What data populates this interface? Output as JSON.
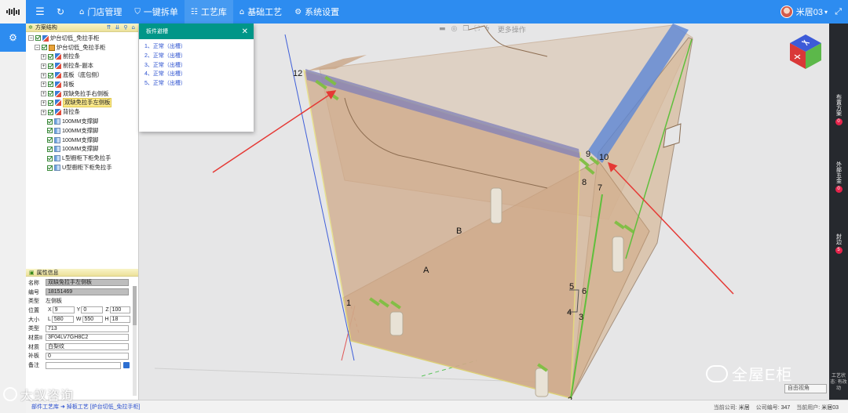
{
  "app": {
    "nav": [
      {
        "icon": "⌂",
        "label": "门店管理"
      },
      {
        "icon": "⛉",
        "label": "一键拆单"
      },
      {
        "icon": "☷",
        "label": "工艺库",
        "active": true
      },
      {
        "icon": "⌂",
        "label": "基础工艺"
      },
      {
        "icon": "⚙",
        "label": "系统设置"
      }
    ],
    "user_name": "米居03",
    "user_caret": "▾"
  },
  "tree": {
    "title": "方案结构",
    "rows": [
      {
        "depth": 0,
        "exp": "−",
        "icon": "board",
        "label": "炉台切低_免拉手柜"
      },
      {
        "depth": 1,
        "exp": "−",
        "icon": "cab",
        "label": "炉台切低_免拉手柜"
      },
      {
        "depth": 2,
        "exp": "+",
        "icon": "board",
        "label": "前拉条"
      },
      {
        "depth": 2,
        "exp": "+",
        "icon": "board",
        "label": "前拉条-副本"
      },
      {
        "depth": 2,
        "exp": "+",
        "icon": "board",
        "label": "底板（底包侧）"
      },
      {
        "depth": 2,
        "exp": "+",
        "icon": "board",
        "label": "背板"
      },
      {
        "depth": 2,
        "exp": "+",
        "icon": "board",
        "label": "双缺免拉手右侧板"
      },
      {
        "depth": 2,
        "exp": "+",
        "icon": "board",
        "label": "双缺免拉手左侧板",
        "selected": true
      },
      {
        "depth": 2,
        "exp": "+",
        "icon": "board",
        "label": "背拉条"
      },
      {
        "depth": 3,
        "exp": "",
        "icon": "leg",
        "label": "100MM支撑脚"
      },
      {
        "depth": 3,
        "exp": "",
        "icon": "leg",
        "label": "100MM支撑脚"
      },
      {
        "depth": 3,
        "exp": "",
        "icon": "leg",
        "label": "100MM支撑脚"
      },
      {
        "depth": 3,
        "exp": "",
        "icon": "leg",
        "label": "100MM支撑脚"
      },
      {
        "depth": 3,
        "exp": "",
        "icon": "leg",
        "label": "L型橱柜下柜免拉手"
      },
      {
        "depth": 3,
        "exp": "",
        "icon": "leg",
        "label": "U型橱柜下柜免拉手"
      }
    ]
  },
  "attributes": {
    "title": "属性信息",
    "name_label": "名称",
    "name_value": "双缺免拉手左侧板",
    "code_label": "编号",
    "code_value": "18151469",
    "type_label": "类型",
    "type_value": "左侧板",
    "pos_label": "位置",
    "pos_x": "9",
    "pos_y": "0",
    "pos_z": "100",
    "size_label": "大小",
    "size_l": "580",
    "size_w": "550",
    "size_h": "18",
    "class_label": "类型",
    "class_value": "713",
    "material_no_label": "材质II",
    "material_no_value": "3F04LV7GH8C2",
    "material_label": "材质",
    "material_value": "白梨纹",
    "fill_label": "补板",
    "fill_value": "0",
    "note_label": "备注",
    "note_value": ""
  },
  "popup": {
    "title": "板件避槽",
    "items": [
      "1、正常（出槽）",
      "2、正常（出槽）",
      "3、正常（出槽）",
      "4、正常（出槽）",
      "5、正常（出槽）"
    ]
  },
  "viewport": {
    "more_ops": "更多操作",
    "view_select": "自由视角",
    "watermark": "全屋E柜",
    "labels": {
      "a": "A",
      "b": "B",
      "n1": "1",
      "n2": "2",
      "n3": "3",
      "n4": "4",
      "n5": "5",
      "n6": "6",
      "n7": "7",
      "n8": "8",
      "n9": "9",
      "n10": "10",
      "n12": "12"
    }
  },
  "right_panel": {
    "buttons": [
      {
        "label": "布置方案",
        "badge": "0"
      },
      {
        "label": "外部五金",
        "badge": "0"
      },
      {
        "label": "封边",
        "badge": "5"
      }
    ],
    "status": "工艺状态: 有改动"
  },
  "footer": {
    "breadcrumb": "部件工艺库 ➜ 掉板工艺 [炉台切低_免拉手柜]",
    "company_label": "当前公司:",
    "company_value": "米居",
    "company_code_label": "公司编号:",
    "company_code_value": "347",
    "user_label": "当前用户:",
    "user_value": "米居03"
  },
  "brand_mark": "大蚁咨询"
}
